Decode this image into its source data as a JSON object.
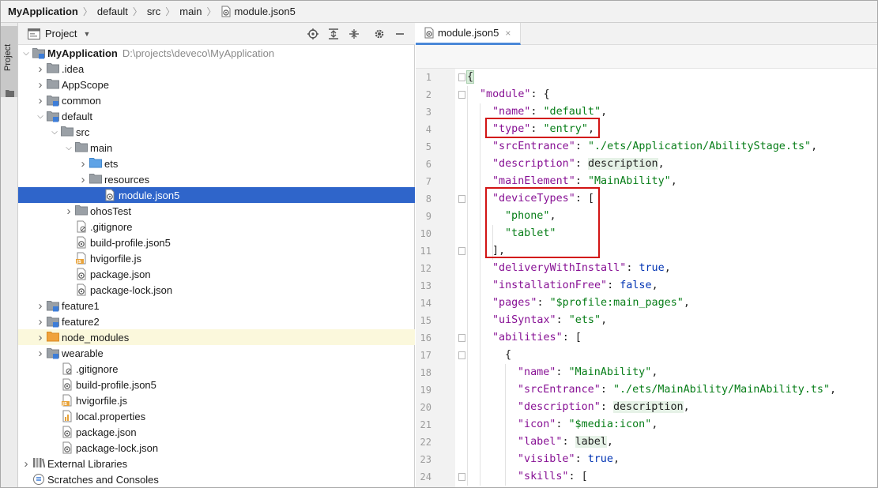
{
  "breadcrumb": {
    "project": "MyApplication",
    "items": [
      "default",
      "src",
      "main",
      "module.json5"
    ]
  },
  "tool_stripe": {
    "label": "Project"
  },
  "project_panel": {
    "title": "Project",
    "tools": [
      "locate-icon",
      "expand-all-icon",
      "collapse-all-icon",
      "gear-icon",
      "minimize-icon"
    ],
    "tree": [
      {
        "label": "MyApplication",
        "path": "D:\\projects\\deveco\\MyApplication",
        "depth": 0,
        "expand": "open",
        "icon": "module-folder",
        "bold": true
      },
      {
        "label": ".idea",
        "depth": 1,
        "expand": "closed",
        "icon": "folder"
      },
      {
        "label": "AppScope",
        "depth": 1,
        "expand": "closed",
        "icon": "folder"
      },
      {
        "label": "common",
        "depth": 1,
        "expand": "closed",
        "icon": "module-folder"
      },
      {
        "label": "default",
        "depth": 1,
        "expand": "open",
        "icon": "module-folder"
      },
      {
        "label": "src",
        "depth": 2,
        "expand": "open",
        "icon": "folder"
      },
      {
        "label": "main",
        "depth": 3,
        "expand": "open",
        "icon": "folder"
      },
      {
        "label": "ets",
        "depth": 4,
        "expand": "closed",
        "icon": "source-folder"
      },
      {
        "label": "resources",
        "depth": 4,
        "expand": "closed",
        "icon": "folder"
      },
      {
        "label": "module.json5",
        "depth": 5,
        "expand": "none",
        "icon": "json-file",
        "selected": true
      },
      {
        "label": "ohosTest",
        "depth": 3,
        "expand": "closed",
        "icon": "folder"
      },
      {
        "label": ".gitignore",
        "depth": 3,
        "expand": "none",
        "icon": "ignore-file"
      },
      {
        "label": "build-profile.json5",
        "depth": 3,
        "expand": "none",
        "icon": "json-file"
      },
      {
        "label": "hvigorfile.js",
        "depth": 3,
        "expand": "none",
        "icon": "js-file"
      },
      {
        "label": "package.json",
        "depth": 3,
        "expand": "none",
        "icon": "json-file"
      },
      {
        "label": "package-lock.json",
        "depth": 3,
        "expand": "none",
        "icon": "json-file"
      },
      {
        "label": "feature1",
        "depth": 1,
        "expand": "closed",
        "icon": "module-folder"
      },
      {
        "label": "feature2",
        "depth": 1,
        "expand": "closed",
        "icon": "module-folder"
      },
      {
        "label": "node_modules",
        "depth": 1,
        "expand": "closed",
        "icon": "orange-folder",
        "highlight": true
      },
      {
        "label": "wearable",
        "depth": 1,
        "expand": "closed",
        "icon": "module-folder"
      },
      {
        "label": ".gitignore",
        "depth": 2,
        "expand": "none",
        "icon": "ignore-file"
      },
      {
        "label": "build-profile.json5",
        "depth": 2,
        "expand": "none",
        "icon": "json-file"
      },
      {
        "label": "hvigorfile.js",
        "depth": 2,
        "expand": "none",
        "icon": "js-file"
      },
      {
        "label": "local.properties",
        "depth": 2,
        "expand": "none",
        "icon": "properties-file"
      },
      {
        "label": "package.json",
        "depth": 2,
        "expand": "none",
        "icon": "json-file"
      },
      {
        "label": "package-lock.json",
        "depth": 2,
        "expand": "none",
        "icon": "json-file"
      },
      {
        "label": "External Libraries",
        "depth": 0,
        "expand": "closed",
        "icon": "library"
      },
      {
        "label": "Scratches and Consoles",
        "depth": 0,
        "expand": "none",
        "icon": "scratches"
      }
    ]
  },
  "editor": {
    "tab": {
      "label": "module.json5",
      "close": "×"
    },
    "lines": [
      {
        "n": "1",
        "tokens": [
          [
            "p",
            "{"
          ]
        ]
      },
      {
        "n": "2",
        "tokens": [
          [
            "k",
            "\"module\""
          ],
          [
            "p",
            ": {"
          ]
        ]
      },
      {
        "n": "3",
        "tokens": [
          [
            "k",
            "\"name\""
          ],
          [
            "p",
            ": "
          ],
          [
            "s",
            "\"default\""
          ],
          [
            "p",
            ","
          ]
        ]
      },
      {
        "n": "4",
        "tokens": [
          [
            "k",
            "\"type\""
          ],
          [
            "p",
            ": "
          ],
          [
            "s",
            "\"entry\""
          ],
          [
            "p",
            ","
          ]
        ]
      },
      {
        "n": "5",
        "tokens": [
          [
            "k",
            "\"srcEntrance\""
          ],
          [
            "p",
            ": "
          ],
          [
            "s",
            "\"./ets/Application/AbilityStage.ts\""
          ],
          [
            "p",
            ","
          ]
        ]
      },
      {
        "n": "6",
        "tokens": [
          [
            "k",
            "\"description\""
          ],
          [
            "p",
            ": "
          ],
          [
            "rf",
            "description"
          ],
          [
            "p",
            ","
          ]
        ]
      },
      {
        "n": "7",
        "tokens": [
          [
            "k",
            "\"mainElement\""
          ],
          [
            "p",
            ": "
          ],
          [
            "s",
            "\"MainAbility\""
          ],
          [
            "p",
            ","
          ]
        ]
      },
      {
        "n": "8",
        "tokens": [
          [
            "k",
            "\"deviceTypes\""
          ],
          [
            "p",
            ": ["
          ]
        ]
      },
      {
        "n": "9",
        "tokens": [
          [
            "s",
            "\"phone\""
          ],
          [
            "p",
            ","
          ]
        ]
      },
      {
        "n": "10",
        "tokens": [
          [
            "s",
            "\"tablet\""
          ]
        ]
      },
      {
        "n": "11",
        "tokens": [
          [
            "p",
            "],"
          ]
        ]
      },
      {
        "n": "12",
        "tokens": [
          [
            "k",
            "\"deliveryWithInstall\""
          ],
          [
            "p",
            ": "
          ],
          [
            "b",
            "true"
          ],
          [
            "p",
            ","
          ]
        ]
      },
      {
        "n": "13",
        "tokens": [
          [
            "k",
            "\"installationFree\""
          ],
          [
            "p",
            ": "
          ],
          [
            "b",
            "false"
          ],
          [
            "p",
            ","
          ]
        ]
      },
      {
        "n": "14",
        "tokens": [
          [
            "k",
            "\"pages\""
          ],
          [
            "p",
            ": "
          ],
          [
            "s",
            "\"$profile:main_pages\""
          ],
          [
            "p",
            ","
          ]
        ]
      },
      {
        "n": "15",
        "tokens": [
          [
            "k",
            "\"uiSyntax\""
          ],
          [
            "p",
            ": "
          ],
          [
            "s",
            "\"ets\""
          ],
          [
            "p",
            ","
          ]
        ]
      },
      {
        "n": "16",
        "tokens": [
          [
            "k",
            "\"abilities\""
          ],
          [
            "p",
            ": ["
          ]
        ]
      },
      {
        "n": "17",
        "tokens": [
          [
            "p",
            "{"
          ]
        ]
      },
      {
        "n": "18",
        "tokens": [
          [
            "k",
            "\"name\""
          ],
          [
            "p",
            ": "
          ],
          [
            "s",
            "\"MainAbility\""
          ],
          [
            "p",
            ","
          ]
        ]
      },
      {
        "n": "19",
        "tokens": [
          [
            "k",
            "\"srcEntrance\""
          ],
          [
            "p",
            ": "
          ],
          [
            "s",
            "\"./ets/MainAbility/MainAbility.ts\""
          ],
          [
            "p",
            ","
          ]
        ]
      },
      {
        "n": "20",
        "tokens": [
          [
            "k",
            "\"description\""
          ],
          [
            "p",
            ": "
          ],
          [
            "rf",
            "description"
          ],
          [
            "p",
            ","
          ]
        ]
      },
      {
        "n": "21",
        "tokens": [
          [
            "k",
            "\"icon\""
          ],
          [
            "p",
            ": "
          ],
          [
            "s",
            "\"$media:icon\""
          ],
          [
            "p",
            ","
          ]
        ]
      },
      {
        "n": "22",
        "tokens": [
          [
            "k",
            "\"label\""
          ],
          [
            "p",
            ": "
          ],
          [
            "rf",
            "label"
          ],
          [
            "p",
            ","
          ]
        ]
      },
      {
        "n": "23",
        "tokens": [
          [
            "k",
            "\"visible\""
          ],
          [
            "p",
            ": "
          ],
          [
            "b",
            "true"
          ],
          [
            "p",
            ","
          ]
        ]
      },
      {
        "n": "24",
        "tokens": [
          [
            "k",
            "\"skills\""
          ],
          [
            "p",
            ": ["
          ]
        ]
      }
    ]
  },
  "colors": {
    "selection": "#2f65ca",
    "annotation": "#d21414",
    "json_key": "#871094",
    "json_string": "#067d17",
    "json_keyword": "#0033b3"
  }
}
